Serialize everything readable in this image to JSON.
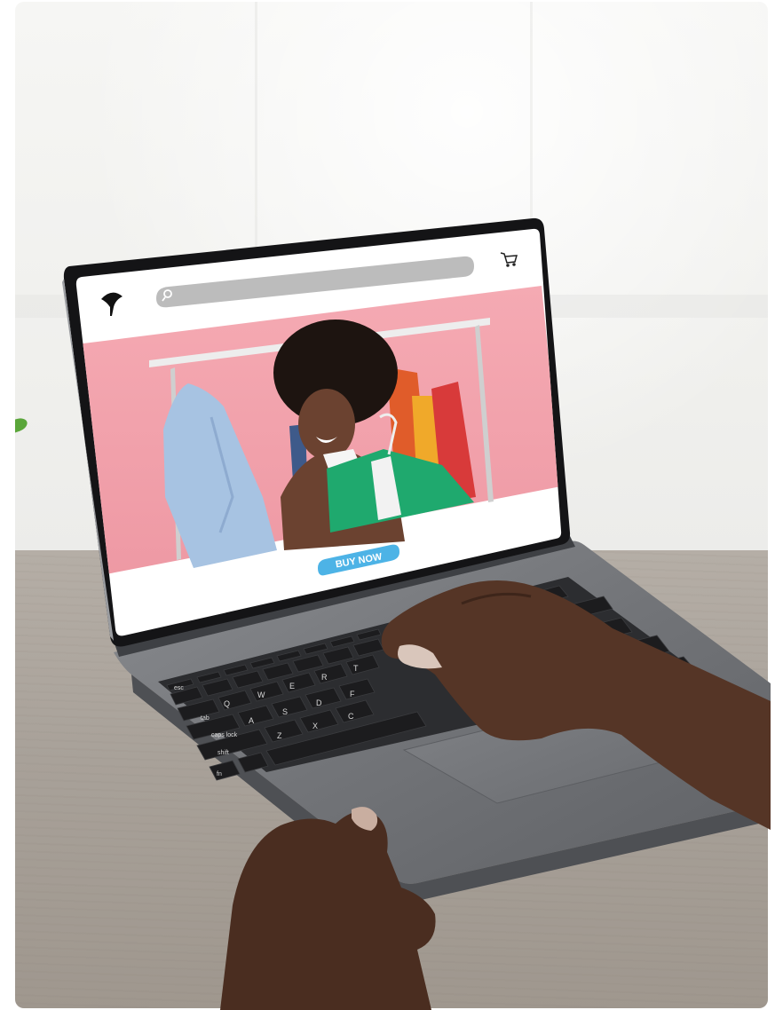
{
  "scene": {
    "description_colors": {
      "wall": "#f0f0ee",
      "table": "#a8a199",
      "laptop_body": "#6f7175",
      "bezel": "#1a1a1c",
      "banner_pink": "#f2a3ad",
      "button_blue": "#4db3e6"
    }
  },
  "website": {
    "logo_icon": "leaf-logo-icon",
    "search_icon": "search-icon",
    "search_placeholder": "",
    "cart_icon": "cart-icon",
    "buy_button_label": "BUY NOW"
  },
  "keyboard": {
    "esc": "esc",
    "tab": "tab",
    "caps": "caps lock",
    "shift": "shift",
    "fn": "fn",
    "row1": [
      "!",
      "@",
      "#",
      "$",
      "%"
    ],
    "row2": [
      "Q",
      "W",
      "E",
      "R",
      "T"
    ],
    "row3": [
      "A",
      "S",
      "D",
      "F"
    ],
    "row4": [
      "Z",
      "X",
      "C"
    ]
  }
}
